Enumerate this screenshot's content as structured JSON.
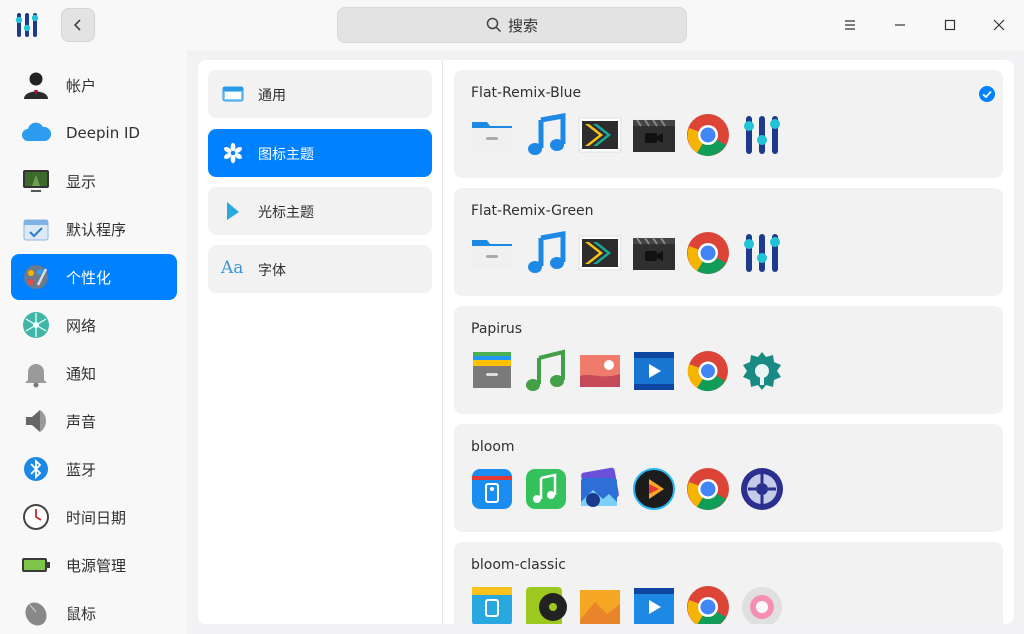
{
  "titlebar": {
    "search_placeholder": "搜索"
  },
  "nav": {
    "items": [
      {
        "label": "帐户",
        "icon": "account-icon"
      },
      {
        "label": "Deepin ID",
        "icon": "cloud-icon"
      },
      {
        "label": "显示",
        "icon": "display-icon"
      },
      {
        "label": "默认程序",
        "icon": "default-apps-icon"
      },
      {
        "label": "个性化",
        "icon": "personalization-icon",
        "active": true
      },
      {
        "label": "网络",
        "icon": "network-icon"
      },
      {
        "label": "通知",
        "icon": "bell-icon"
      },
      {
        "label": "声音",
        "icon": "speaker-icon"
      },
      {
        "label": "蓝牙",
        "icon": "bluetooth-icon"
      },
      {
        "label": "时间日期",
        "icon": "clock-icon"
      },
      {
        "label": "电源管理",
        "icon": "battery-icon"
      },
      {
        "label": "鼠标",
        "icon": "mouse-icon"
      }
    ]
  },
  "sub_nav": {
    "items": [
      {
        "label": "通用",
        "icon": "window-icon"
      },
      {
        "label": "图标主题",
        "icon": "snowflake-icon",
        "active": true
      },
      {
        "label": "光标主题",
        "icon": "cursor-icon"
      },
      {
        "label": "字体",
        "icon": "font-icon",
        "glyph": "Aa"
      }
    ]
  },
  "themes": [
    {
      "name": "Flat-Remix-Blue",
      "selected": true
    },
    {
      "name": "Flat-Remix-Green",
      "selected": false
    },
    {
      "name": "Papirus",
      "selected": false
    },
    {
      "name": "bloom",
      "selected": false
    },
    {
      "name": "bloom-classic",
      "selected": false
    }
  ],
  "colors": {
    "accent": "#0081ff",
    "nav_bg": "#f8f8f8",
    "card_bg": "#f2f2f2"
  }
}
